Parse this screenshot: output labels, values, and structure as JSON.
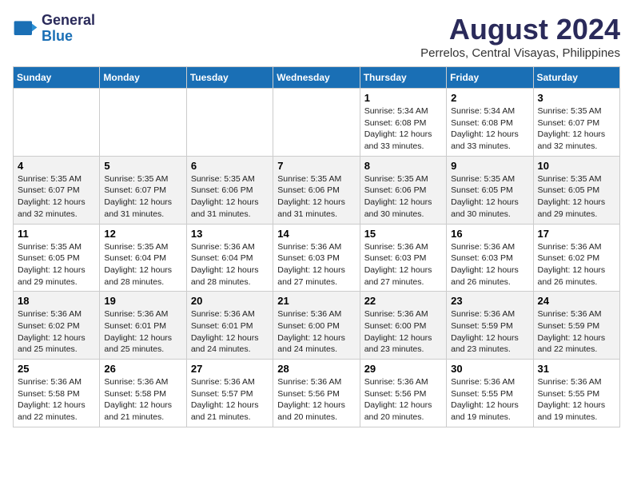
{
  "header": {
    "logo_line1": "General",
    "logo_line2": "Blue",
    "title": "August 2024",
    "subtitle": "Perrelos, Central Visayas, Philippines"
  },
  "days_of_week": [
    "Sunday",
    "Monday",
    "Tuesday",
    "Wednesday",
    "Thursday",
    "Friday",
    "Saturday"
  ],
  "weeks": [
    [
      {
        "day": "",
        "detail": ""
      },
      {
        "day": "",
        "detail": ""
      },
      {
        "day": "",
        "detail": ""
      },
      {
        "day": "",
        "detail": ""
      },
      {
        "day": "1",
        "detail": "Sunrise: 5:34 AM\nSunset: 6:08 PM\nDaylight: 12 hours\nand 33 minutes."
      },
      {
        "day": "2",
        "detail": "Sunrise: 5:34 AM\nSunset: 6:08 PM\nDaylight: 12 hours\nand 33 minutes."
      },
      {
        "day": "3",
        "detail": "Sunrise: 5:35 AM\nSunset: 6:07 PM\nDaylight: 12 hours\nand 32 minutes."
      }
    ],
    [
      {
        "day": "4",
        "detail": "Sunrise: 5:35 AM\nSunset: 6:07 PM\nDaylight: 12 hours\nand 32 minutes."
      },
      {
        "day": "5",
        "detail": "Sunrise: 5:35 AM\nSunset: 6:07 PM\nDaylight: 12 hours\nand 31 minutes."
      },
      {
        "day": "6",
        "detail": "Sunrise: 5:35 AM\nSunset: 6:06 PM\nDaylight: 12 hours\nand 31 minutes."
      },
      {
        "day": "7",
        "detail": "Sunrise: 5:35 AM\nSunset: 6:06 PM\nDaylight: 12 hours\nand 31 minutes."
      },
      {
        "day": "8",
        "detail": "Sunrise: 5:35 AM\nSunset: 6:06 PM\nDaylight: 12 hours\nand 30 minutes."
      },
      {
        "day": "9",
        "detail": "Sunrise: 5:35 AM\nSunset: 6:05 PM\nDaylight: 12 hours\nand 30 minutes."
      },
      {
        "day": "10",
        "detail": "Sunrise: 5:35 AM\nSunset: 6:05 PM\nDaylight: 12 hours\nand 29 minutes."
      }
    ],
    [
      {
        "day": "11",
        "detail": "Sunrise: 5:35 AM\nSunset: 6:05 PM\nDaylight: 12 hours\nand 29 minutes."
      },
      {
        "day": "12",
        "detail": "Sunrise: 5:35 AM\nSunset: 6:04 PM\nDaylight: 12 hours\nand 28 minutes."
      },
      {
        "day": "13",
        "detail": "Sunrise: 5:36 AM\nSunset: 6:04 PM\nDaylight: 12 hours\nand 28 minutes."
      },
      {
        "day": "14",
        "detail": "Sunrise: 5:36 AM\nSunset: 6:03 PM\nDaylight: 12 hours\nand 27 minutes."
      },
      {
        "day": "15",
        "detail": "Sunrise: 5:36 AM\nSunset: 6:03 PM\nDaylight: 12 hours\nand 27 minutes."
      },
      {
        "day": "16",
        "detail": "Sunrise: 5:36 AM\nSunset: 6:03 PM\nDaylight: 12 hours\nand 26 minutes."
      },
      {
        "day": "17",
        "detail": "Sunrise: 5:36 AM\nSunset: 6:02 PM\nDaylight: 12 hours\nand 26 minutes."
      }
    ],
    [
      {
        "day": "18",
        "detail": "Sunrise: 5:36 AM\nSunset: 6:02 PM\nDaylight: 12 hours\nand 25 minutes."
      },
      {
        "day": "19",
        "detail": "Sunrise: 5:36 AM\nSunset: 6:01 PM\nDaylight: 12 hours\nand 25 minutes."
      },
      {
        "day": "20",
        "detail": "Sunrise: 5:36 AM\nSunset: 6:01 PM\nDaylight: 12 hours\nand 24 minutes."
      },
      {
        "day": "21",
        "detail": "Sunrise: 5:36 AM\nSunset: 6:00 PM\nDaylight: 12 hours\nand 24 minutes."
      },
      {
        "day": "22",
        "detail": "Sunrise: 5:36 AM\nSunset: 6:00 PM\nDaylight: 12 hours\nand 23 minutes."
      },
      {
        "day": "23",
        "detail": "Sunrise: 5:36 AM\nSunset: 5:59 PM\nDaylight: 12 hours\nand 23 minutes."
      },
      {
        "day": "24",
        "detail": "Sunrise: 5:36 AM\nSunset: 5:59 PM\nDaylight: 12 hours\nand 22 minutes."
      }
    ],
    [
      {
        "day": "25",
        "detail": "Sunrise: 5:36 AM\nSunset: 5:58 PM\nDaylight: 12 hours\nand 22 minutes."
      },
      {
        "day": "26",
        "detail": "Sunrise: 5:36 AM\nSunset: 5:58 PM\nDaylight: 12 hours\nand 21 minutes."
      },
      {
        "day": "27",
        "detail": "Sunrise: 5:36 AM\nSunset: 5:57 PM\nDaylight: 12 hours\nand 21 minutes."
      },
      {
        "day": "28",
        "detail": "Sunrise: 5:36 AM\nSunset: 5:56 PM\nDaylight: 12 hours\nand 20 minutes."
      },
      {
        "day": "29",
        "detail": "Sunrise: 5:36 AM\nSunset: 5:56 PM\nDaylight: 12 hours\nand 20 minutes."
      },
      {
        "day": "30",
        "detail": "Sunrise: 5:36 AM\nSunset: 5:55 PM\nDaylight: 12 hours\nand 19 minutes."
      },
      {
        "day": "31",
        "detail": "Sunrise: 5:36 AM\nSunset: 5:55 PM\nDaylight: 12 hours\nand 19 minutes."
      }
    ]
  ]
}
